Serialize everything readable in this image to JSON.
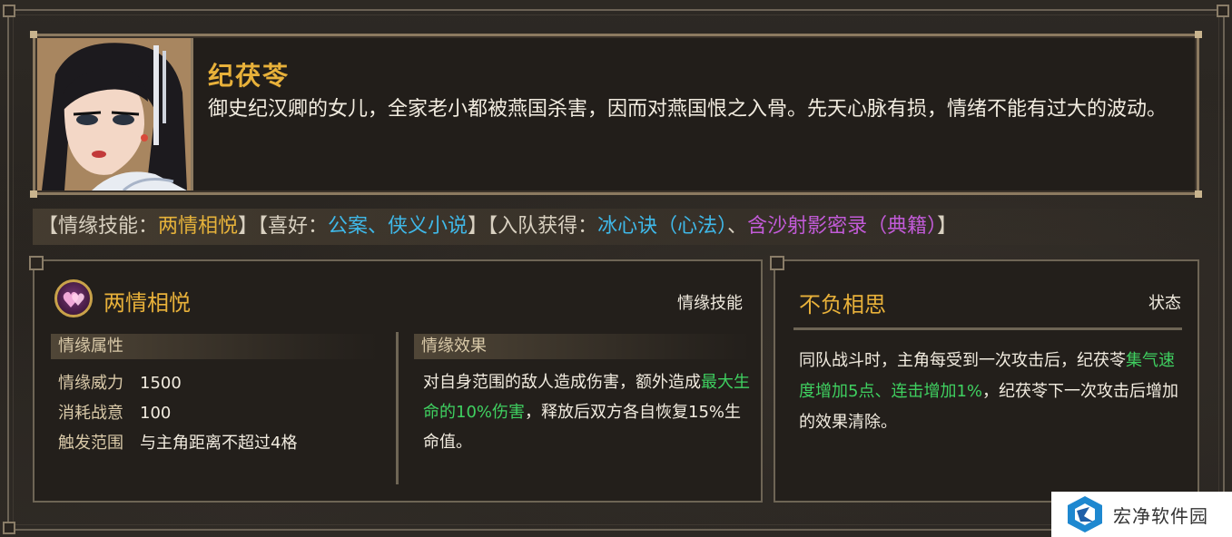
{
  "character": {
    "name": "纪茯苓",
    "description": "御史纪汉卿的女儿，全家老小都被燕国杀害，因而对燕国恨之入骨。先天心脉有损，情绪不能有过大的波动。"
  },
  "info_bar": {
    "open1": "【情缘技能：",
    "skill": "两情相悦",
    "close1": "】【喜好：",
    "hobbies": "公案、侠义小说",
    "close2": "】【入队获得：",
    "reward1": "冰心诀（心法）",
    "sep": "、",
    "reward2": "含沙射影密录（典籍）",
    "close3": "】"
  },
  "skill_panel": {
    "title": "两情相悦",
    "type": "情缘技能",
    "attributes_header": "情缘属性",
    "attributes": [
      {
        "key": "情缘威力",
        "value": "1500"
      },
      {
        "key": "消耗战意",
        "value": "100"
      },
      {
        "key": "触发范围",
        "value": "与主角距离不超过4格"
      }
    ],
    "effect_header": "情缘效果",
    "effect_pre": "对自身范围的敌人造成伤害，额外造成",
    "effect_highlight": "最大生命的10%伤害",
    "effect_post": "，释放后双方各自恢复15%生命值。"
  },
  "status_panel": {
    "title": "不负相思",
    "type": "状态",
    "text_pre": "同队战斗时，主角每受到一次攻击后，纪茯苓",
    "text_highlight": "集气速度增加5点、连击增加1%",
    "text_post": "，纪茯苓下一次攻击后增加的效果清除。"
  },
  "watermark": {
    "text": "宏净软件园"
  },
  "colors": {
    "gold": "#e8b13a",
    "cyan": "#3fb8e8",
    "purple": "#c25bd8",
    "green": "#3fd060"
  },
  "icons": {
    "skill_icon": "double-heart-icon",
    "watermark_logo": "hexagon-logo-icon"
  }
}
